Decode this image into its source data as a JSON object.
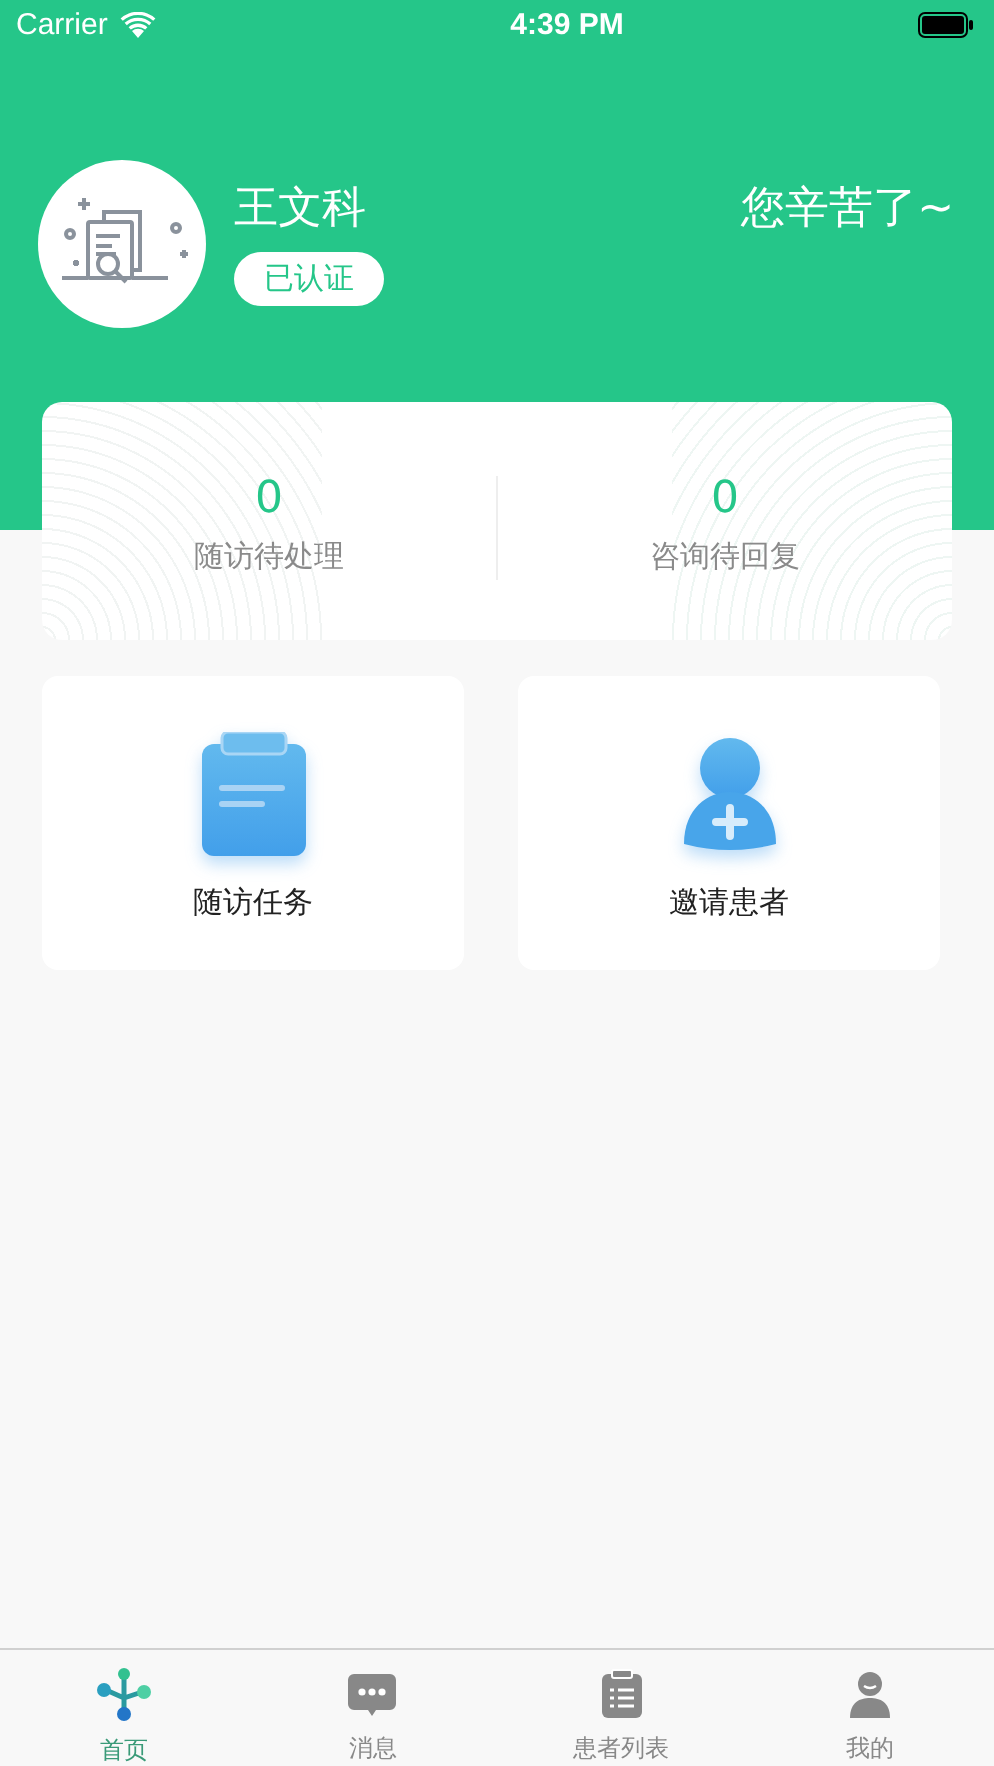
{
  "status_bar": {
    "carrier": "Carrier",
    "time": "4:39 PM"
  },
  "profile": {
    "name": "王文科",
    "badge": "已认证",
    "greeting": "您辛苦了~"
  },
  "stats": [
    {
      "value": "0",
      "label": "随访待处理"
    },
    {
      "value": "0",
      "label": "咨询待回复"
    }
  ],
  "actions": [
    {
      "kind": "clipboard",
      "label": "随访任务"
    },
    {
      "kind": "person",
      "label": "邀请患者"
    }
  ],
  "tabs": [
    {
      "kind": "home",
      "label": "首页",
      "selected": true
    },
    {
      "kind": "chat",
      "label": "消息",
      "selected": false
    },
    {
      "kind": "list",
      "label": "患者列表",
      "selected": false
    },
    {
      "kind": "user",
      "label": "我的",
      "selected": false
    }
  ]
}
